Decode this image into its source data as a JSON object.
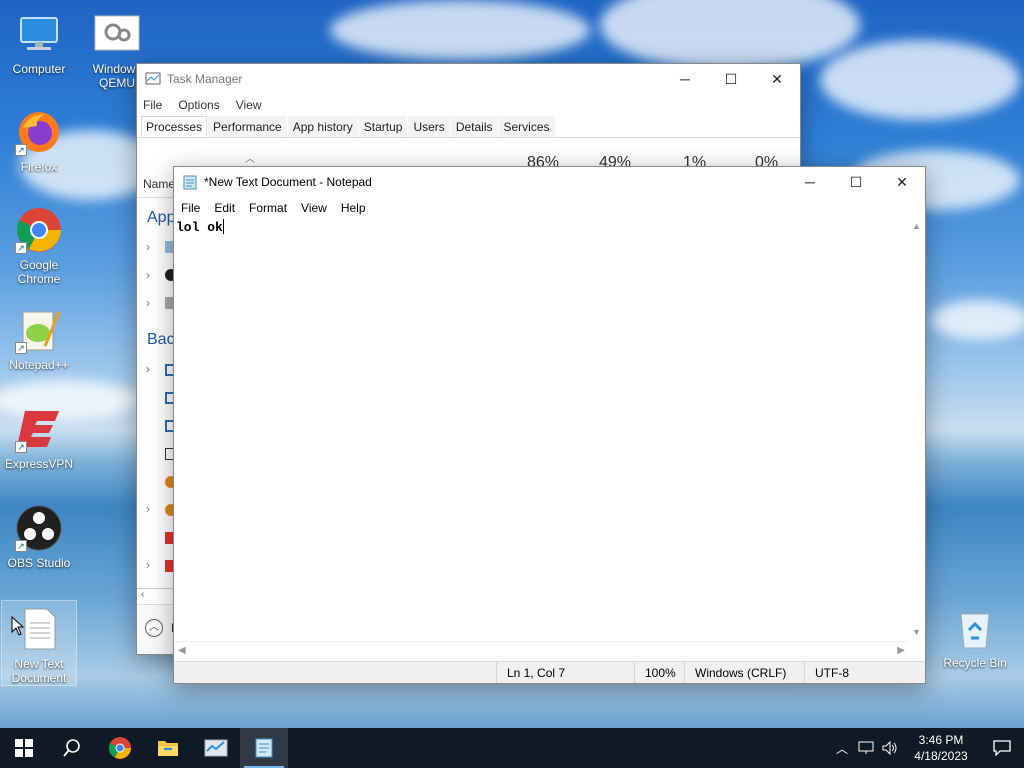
{
  "desktop": {
    "icons": [
      {
        "label_line1": "Computer",
        "label_line2": ""
      },
      {
        "label_line1": "Windows",
        "label_line2": "QEMU"
      },
      {
        "label_line1": "Firefox",
        "label_line2": ""
      },
      {
        "label_line1": "Google",
        "label_line2": "Chrome"
      },
      {
        "label_line1": "Notepad++",
        "label_line2": ""
      },
      {
        "label_line1": "ExpressVPN",
        "label_line2": ""
      },
      {
        "label_line1": "OBS Studio",
        "label_line2": ""
      },
      {
        "label_line1": "New Text",
        "label_line2": "Document"
      },
      {
        "label_line1": "Recycle Bin",
        "label_line2": ""
      }
    ]
  },
  "task_manager": {
    "title": "Task Manager",
    "menu": [
      "File",
      "Options",
      "View"
    ],
    "tabs": [
      "Processes",
      "Performance",
      "App history",
      "Startup",
      "Users",
      "Details",
      "Services"
    ],
    "active_tab": "Processes",
    "usage": {
      "cpu": "86%",
      "memory": "49%",
      "disk": "1%",
      "network": "0%"
    },
    "name_column": "Name",
    "section_apps": "App",
    "section_background": "Bac",
    "footer_partial": "F",
    "icons": {
      "minimize": "minimize-icon",
      "maximize": "maximize-icon",
      "close": "close-icon"
    }
  },
  "notepad": {
    "title": "*New Text Document - Notepad",
    "menu": [
      "File",
      "Edit",
      "Format",
      "View",
      "Help"
    ],
    "content": "lol ok",
    "status": {
      "position": "Ln 1, Col 7",
      "zoom": "100%",
      "line_ending": "Windows (CRLF)",
      "encoding": "UTF-8"
    }
  },
  "taskbar": {
    "clock_time": "3:46 PM",
    "clock_date": "4/18/2023",
    "accent": "#76b9ed",
    "background": "#101a26"
  }
}
